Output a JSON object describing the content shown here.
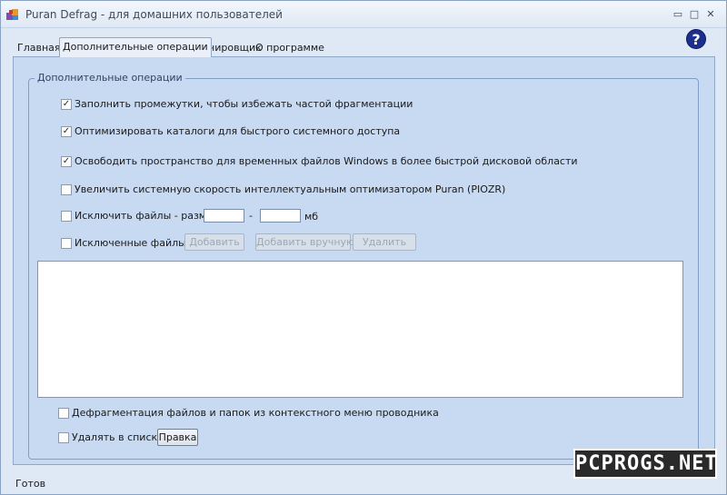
{
  "window": {
    "title": "Puran Defrag - для домашних пользователей",
    "icon": "app-puzzle-icon",
    "controls": {
      "minimize": "▭",
      "maximize": "□",
      "close": "✕"
    }
  },
  "tabs": [
    {
      "label": "Главная",
      "active": false
    },
    {
      "label": "Дополнительные операции",
      "active": true
    },
    {
      "label": "Планировщик",
      "active": false
    },
    {
      "label": "О программе",
      "active": false
    }
  ],
  "help": {
    "glyph": "?"
  },
  "group": {
    "title": "Дополнительные операции",
    "options": [
      {
        "label": "Заполнить промежутки, чтобы избежать частой фрагментации",
        "checked": true
      },
      {
        "label": "Оптимизировать каталоги для быстрого системного доступа",
        "checked": true
      },
      {
        "label": "Освободить пространство для временных файлов Windows в более быстрой дисковой области",
        "checked": true
      },
      {
        "label": "Увеличить системную скорость интеллектуальным оптимизатором Puran (PIOZR)",
        "checked": false
      },
      {
        "label": "Исключить файлы - размер",
        "checked": false
      },
      {
        "label": "Исключенные файлы",
        "checked": false
      },
      {
        "label": "Дефрагментация файлов и папок из контекстного меню проводника",
        "checked": false
      },
      {
        "label": "Удалять в списке",
        "checked": false
      }
    ],
    "size_range": {
      "from_value": "",
      "separator": "-",
      "to_value": "",
      "unit": "мб"
    },
    "buttons": {
      "add": "Добавить",
      "add_manual": "Добавить вручную",
      "remove": "Удалить",
      "edit": "Правка"
    }
  },
  "status": {
    "text": "Готов"
  },
  "watermark": {
    "text": "PCPROGS.NET"
  },
  "colors": {
    "window_bg": "#dfe9f6",
    "panel_bg": "#c7daf2",
    "help_bg": "#1c2f8f"
  }
}
